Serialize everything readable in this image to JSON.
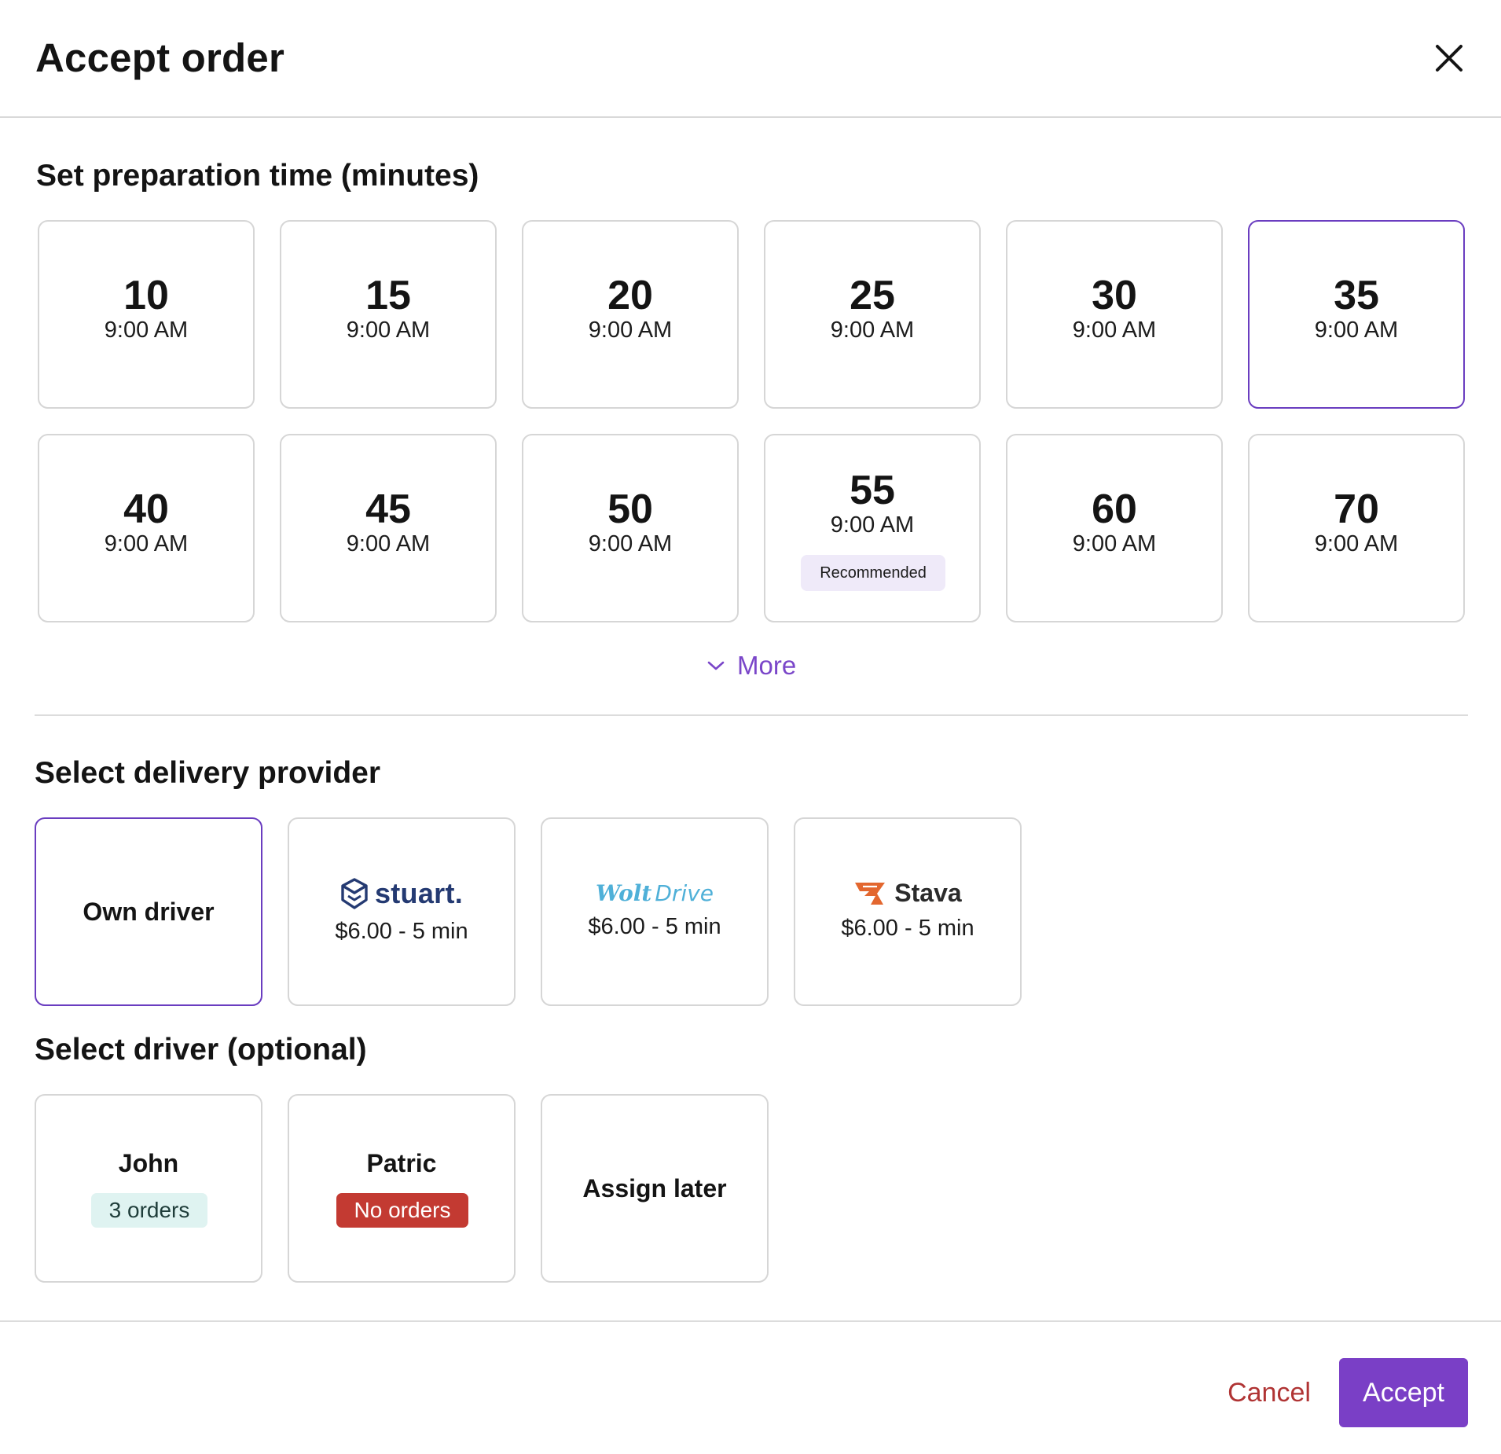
{
  "header": {
    "title": "Accept order",
    "close_icon": "close-icon"
  },
  "prep": {
    "title": "Set preparation time (minutes)",
    "options": [
      {
        "minutes": "10",
        "time": "9:00 AM",
        "selected": false
      },
      {
        "minutes": "15",
        "time": "9:00 AM",
        "selected": false
      },
      {
        "minutes": "20",
        "time": "9:00 AM",
        "selected": false
      },
      {
        "minutes": "25",
        "time": "9:00 AM",
        "selected": false
      },
      {
        "minutes": "30",
        "time": "9:00 AM",
        "selected": false
      },
      {
        "minutes": "35",
        "time": "9:00 AM",
        "selected": true
      },
      {
        "minutes": "40",
        "time": "9:00 AM",
        "selected": false
      },
      {
        "minutes": "45",
        "time": "9:00 AM",
        "selected": false
      },
      {
        "minutes": "50",
        "time": "9:00 AM",
        "selected": false
      },
      {
        "minutes": "55",
        "time": "9:00 AM",
        "selected": false,
        "badge": "Recommended"
      },
      {
        "minutes": "60",
        "time": "9:00 AM",
        "selected": false
      },
      {
        "minutes": "70",
        "time": "9:00 AM",
        "selected": false
      }
    ],
    "more_label": "More"
  },
  "delivery": {
    "title": "Select delivery provider",
    "providers": [
      {
        "label": "Own driver",
        "selected": true
      },
      {
        "logo_text": "stuart.",
        "price": "$6.00 - 5 min",
        "selected": false
      },
      {
        "logo_text_a": "Wolt",
        "logo_text_b": "Drive",
        "price": "$6.00 - 5 min",
        "selected": false
      },
      {
        "logo_text": "Stava",
        "price": "$6.00 - 5 min",
        "selected": false
      }
    ]
  },
  "driver": {
    "title": "Select driver (optional)",
    "drivers": [
      {
        "name": "John",
        "badge": "3 orders",
        "badge_color": "#dff3f1"
      },
      {
        "name": "Patric",
        "badge": "No orders",
        "badge_color": "#c33a32"
      },
      {
        "name": "Assign later"
      }
    ]
  },
  "footer": {
    "cancel_label": "Cancel",
    "accept_label": "Accept"
  },
  "colors": {
    "accent": "#7a3fc6",
    "selected_border": "#6a3dc0",
    "danger": "#b03434"
  }
}
